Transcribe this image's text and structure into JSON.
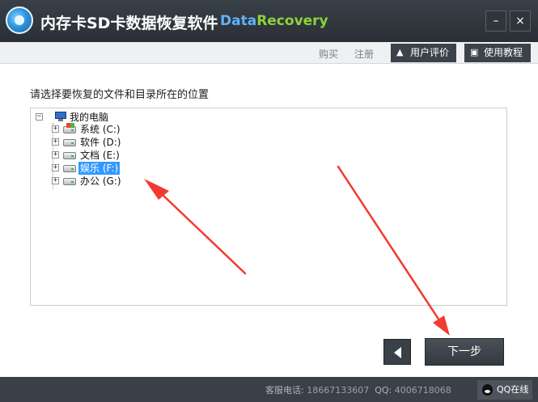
{
  "window": {
    "title": "内存卡SD卡数据恢复软件",
    "brand_part1": "Data",
    "brand_part2": "Recovery",
    "minimize_glyph": "–",
    "close_glyph": "×"
  },
  "menu": {
    "buy": "购买",
    "register": "注册",
    "review": "用户评价",
    "tutorial": "使用教程",
    "review_icon": "thumbs-up-icon",
    "tutorial_icon": "book-icon"
  },
  "content": {
    "instruction": "请选择要恢复的文件和目录所在的位置",
    "tree": {
      "root": {
        "label": "我的电脑",
        "icon": "computer-icon",
        "expander": "−"
      },
      "drives": [
        {
          "label": "系统 (C:)",
          "icon": "system-drive-icon",
          "expander": "+",
          "selected": false
        },
        {
          "label": "软件 (D:)",
          "icon": "drive-icon",
          "expander": "+",
          "selected": false
        },
        {
          "label": "文档 (E:)",
          "icon": "drive-icon",
          "expander": "+",
          "selected": false
        },
        {
          "label": "娱乐 (F:)",
          "icon": "drive-icon",
          "expander": "+",
          "selected": true
        },
        {
          "label": "办公 (G:)",
          "icon": "drive-icon",
          "expander": "+",
          "selected": false
        }
      ]
    }
  },
  "nav": {
    "next": "下一步",
    "back_icon": "chevron-left-icon"
  },
  "status": {
    "contact_label": "客服电话:",
    "phone": "18667133607",
    "qq_label": "QQ:",
    "qq_number": "4006718068",
    "qq_online": "QQ在线"
  },
  "colors": {
    "titlebar": "#2f353b",
    "brand_blue": "#5fb2ff",
    "brand_green": "#8cd23a",
    "selection": "#3399ff",
    "annotation_arrow": "#f23b2f"
  }
}
